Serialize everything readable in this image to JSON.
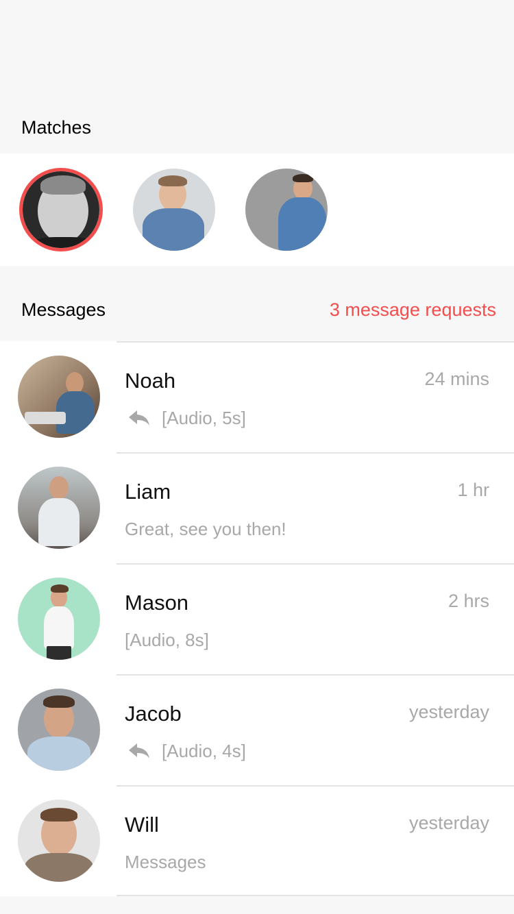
{
  "matches": {
    "title": "Matches",
    "avatars": [
      {
        "name": "match-1",
        "active": true
      },
      {
        "name": "match-2",
        "active": false
      },
      {
        "name": "match-3",
        "active": false
      }
    ]
  },
  "messages_section": {
    "title": "Messages",
    "requests_label": "3 message requests"
  },
  "conversations": [
    {
      "name": "Noah",
      "time": "24 mins",
      "preview": "[Audio, 5s]",
      "replied": true
    },
    {
      "name": "Liam",
      "time": "1 hr",
      "preview": "Great, see you then!",
      "replied": false
    },
    {
      "name": "Mason",
      "time": "2 hrs",
      "preview": "[Audio, 8s]",
      "replied": false
    },
    {
      "name": "Jacob",
      "time": "yesterday",
      "preview": "[Audio, 4s]",
      "replied": true
    },
    {
      "name": "Will",
      "time": "yesterday",
      "preview": "Messages",
      "replied": false
    }
  ],
  "colors": {
    "accent": "#f24e4e",
    "secondary_text": "#a8a8a8",
    "background": "#f7f7f7",
    "divider": "#e3e3e3"
  },
  "icons": {
    "reply": "reply-arrow-icon"
  }
}
